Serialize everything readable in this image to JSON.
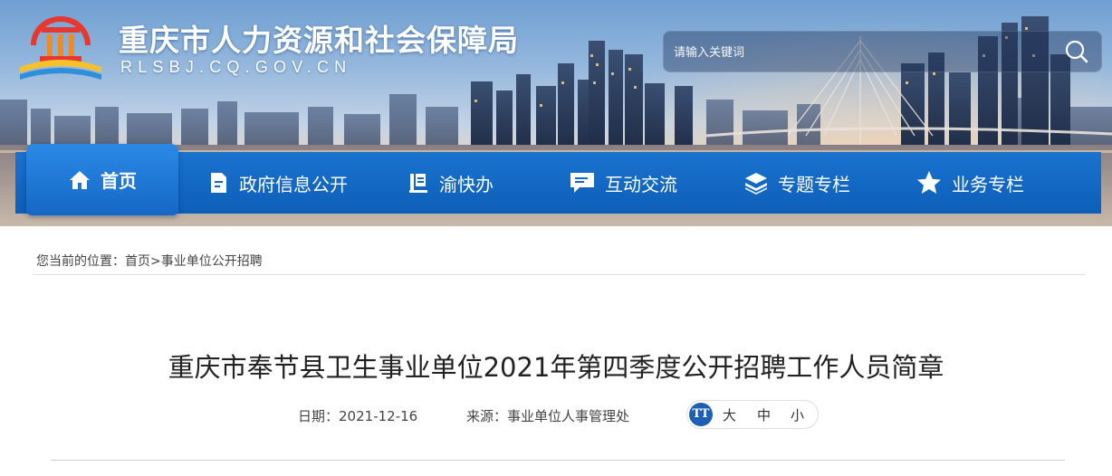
{
  "header": {
    "site_title": "重庆市人力资源和社会保障局",
    "site_domain": "RLSBJ.CQ.GOV.CN",
    "search_placeholder": "请输入关键词"
  },
  "nav": {
    "items": [
      {
        "label": "首页",
        "icon": "home-icon",
        "active": true
      },
      {
        "label": "政府信息公开",
        "icon": "document-icon"
      },
      {
        "label": "渝快办",
        "icon": "book-stack-icon"
      },
      {
        "label": "互动交流",
        "icon": "chat-bubble-icon"
      },
      {
        "label": "专题专栏",
        "icon": "layers-icon"
      },
      {
        "label": "业务专栏",
        "icon": "star-icon"
      }
    ]
  },
  "breadcrumb": {
    "prefix": "您当前的位置：",
    "home": "首页",
    "separator": ">",
    "current": "事业单位公开招聘"
  },
  "article": {
    "title": "重庆市奉节县卫生事业单位2021年第四季度公开招聘工作人员简章",
    "date_label": "日期：",
    "date": "2021-12-16",
    "source_label": "来源：",
    "source": "事业单位人事管理处"
  },
  "font_size": {
    "icon_text": "TT",
    "large": "大",
    "medium": "中",
    "small": "小"
  },
  "colors": {
    "nav_blue": "#0d5eb8",
    "nav_active": "#2b8ae6",
    "font_icon_blue": "#1d5fb3"
  }
}
